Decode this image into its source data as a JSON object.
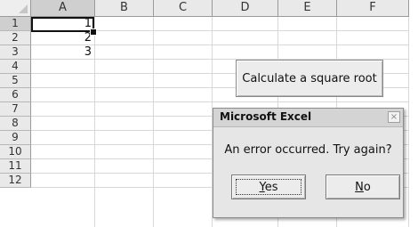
{
  "columns": [
    "A",
    "B",
    "C",
    "D",
    "E",
    "F"
  ],
  "rows": [
    "1",
    "2",
    "3",
    "4",
    "5",
    "6",
    "7",
    "8",
    "9",
    "10",
    "11",
    "12"
  ],
  "cells": {
    "A1": "1",
    "A2": "2",
    "A3": "3"
  },
  "sheet_button": {
    "label": "Calculate a square root"
  },
  "dialog": {
    "title": "Microsoft Excel",
    "close_symbol": "×",
    "message": "An error occurred. Try again?",
    "yes_label_ul": "Y",
    "yes_label_rest": "es",
    "no_label_ul": "N",
    "no_label_rest": "o"
  }
}
